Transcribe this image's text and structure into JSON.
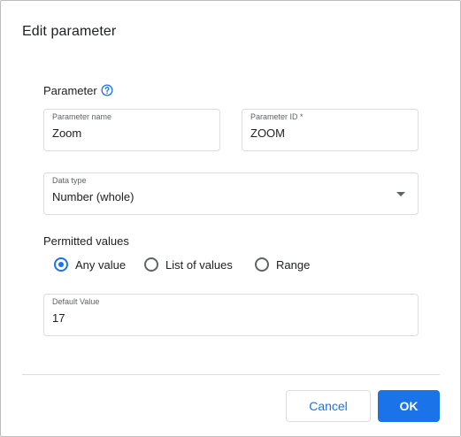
{
  "dialog": {
    "title": "Edit parameter"
  },
  "parameter": {
    "section_label": "Parameter",
    "name": {
      "label": "Parameter name",
      "value": "Zoom"
    },
    "id": {
      "label": "Parameter ID *",
      "value": "ZOOM"
    }
  },
  "data_type": {
    "label": "Data type",
    "selected": "Number (whole)"
  },
  "permitted_values": {
    "section_label": "Permitted values",
    "options": [
      {
        "label": "Any value",
        "checked": true
      },
      {
        "label": "List of values",
        "checked": false
      },
      {
        "label": "Range",
        "checked": false
      }
    ]
  },
  "default_value": {
    "label": "Default Value",
    "value": "17"
  },
  "buttons": {
    "cancel": "Cancel",
    "ok": "OK"
  },
  "colors": {
    "accent": "#1a73e8",
    "border": "#dadce0",
    "text": "#202124"
  },
  "icons": {
    "help": "help-circle-icon",
    "dropdown": "dropdown-arrow-icon"
  }
}
